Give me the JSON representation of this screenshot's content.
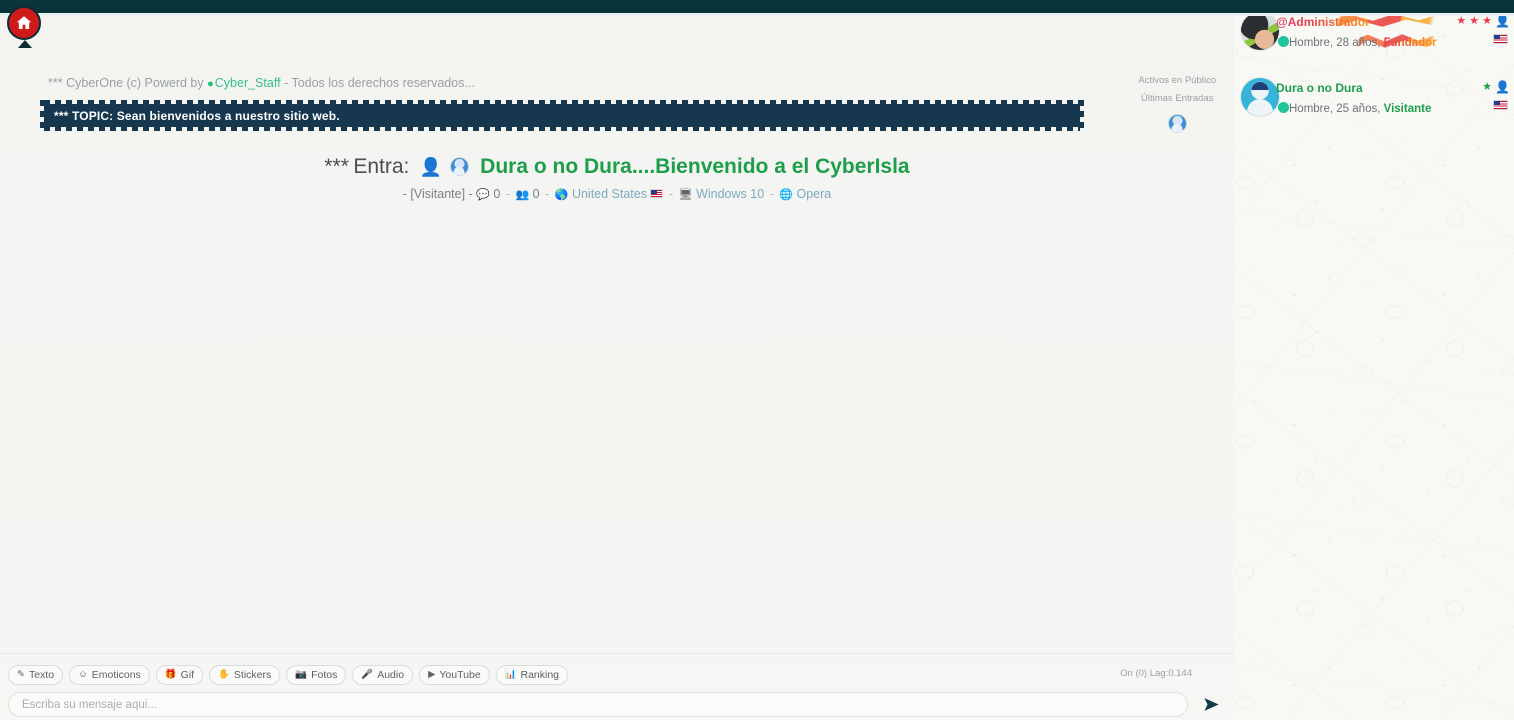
{
  "app": {
    "logo_icon": "home-icon",
    "topbar_color": "#0a343c"
  },
  "chat": {
    "copyright": {
      "prefix": "*** CyberOne (c) Powerd by",
      "shield_icon": "shield-icon",
      "staff_link": "Cyber_Staff",
      "suffix": "- Todos los derechos reservados..."
    },
    "topic": {
      "text": "*** TOPIC: Sean bienvenidos a nuestro sitio web."
    },
    "entry": {
      "stars": "***",
      "label": "Entra:",
      "person_icon": "person-icon",
      "avatar_icon": "avatar-icon",
      "username": "Dura o no Dura....Bienvenido a el CyberIsla"
    },
    "entry_meta": {
      "role": "- [Visitante] -",
      "chat_icon": "chat-bubble-icon",
      "messages_count": "0",
      "users_icon": "users-icon",
      "users_count": "0",
      "globe_icon": "globe-icon",
      "country": "United States",
      "flag_icon": "us-flag-icon",
      "monitor_icon": "monitor-icon",
      "os": "Windows 10",
      "browser_icon": "browser-globe-icon",
      "browser": "Opera"
    },
    "side_labels": {
      "active": "Activos en Público",
      "recent": "Últimas Entradas",
      "avatar_icon": "avatar-icon"
    }
  },
  "composer": {
    "tools": [
      {
        "label": "Texto",
        "icon": "pencil-square-icon"
      },
      {
        "label": "Emoticons",
        "icon": "smiley-icon"
      },
      {
        "label": "Gif",
        "icon": "gift-icon"
      },
      {
        "label": "Stickers",
        "icon": "sticker-icon"
      },
      {
        "label": "Fotos",
        "icon": "camera-icon"
      },
      {
        "label": "Audio",
        "icon": "microphone-icon"
      },
      {
        "label": "YouTube",
        "icon": "play-icon"
      },
      {
        "label": "Ranking",
        "icon": "bar-chart-icon"
      }
    ],
    "status": "On (0) Lag:0.144",
    "input_value": "",
    "input_placeholder": "Escriba su mensaje aqui...",
    "send_icon": "send-icon"
  },
  "sidebar": {
    "users": [
      {
        "name": "@Administrador",
        "avatar": "photo-avatar",
        "status_dot": "#1fc49b",
        "details": "Hombre, 28 años,",
        "role": "Fundador",
        "role_color": "#f0662f",
        "stars": 3,
        "star_color": "#e8394f",
        "person_icon": "person-icon",
        "flag_icon": "us-flag-icon"
      },
      {
        "name": "Dura o no Dura",
        "avatar": "default-avatar",
        "status_dot": "#1fc49b",
        "details": "Hombre, 25 años,",
        "role": "Visitante",
        "role_color": "#1e9e4a",
        "stars": 1,
        "star_color": "#1e9e4a",
        "person_icon": "person-icon",
        "flag_icon": "us-flag-icon"
      }
    ]
  }
}
